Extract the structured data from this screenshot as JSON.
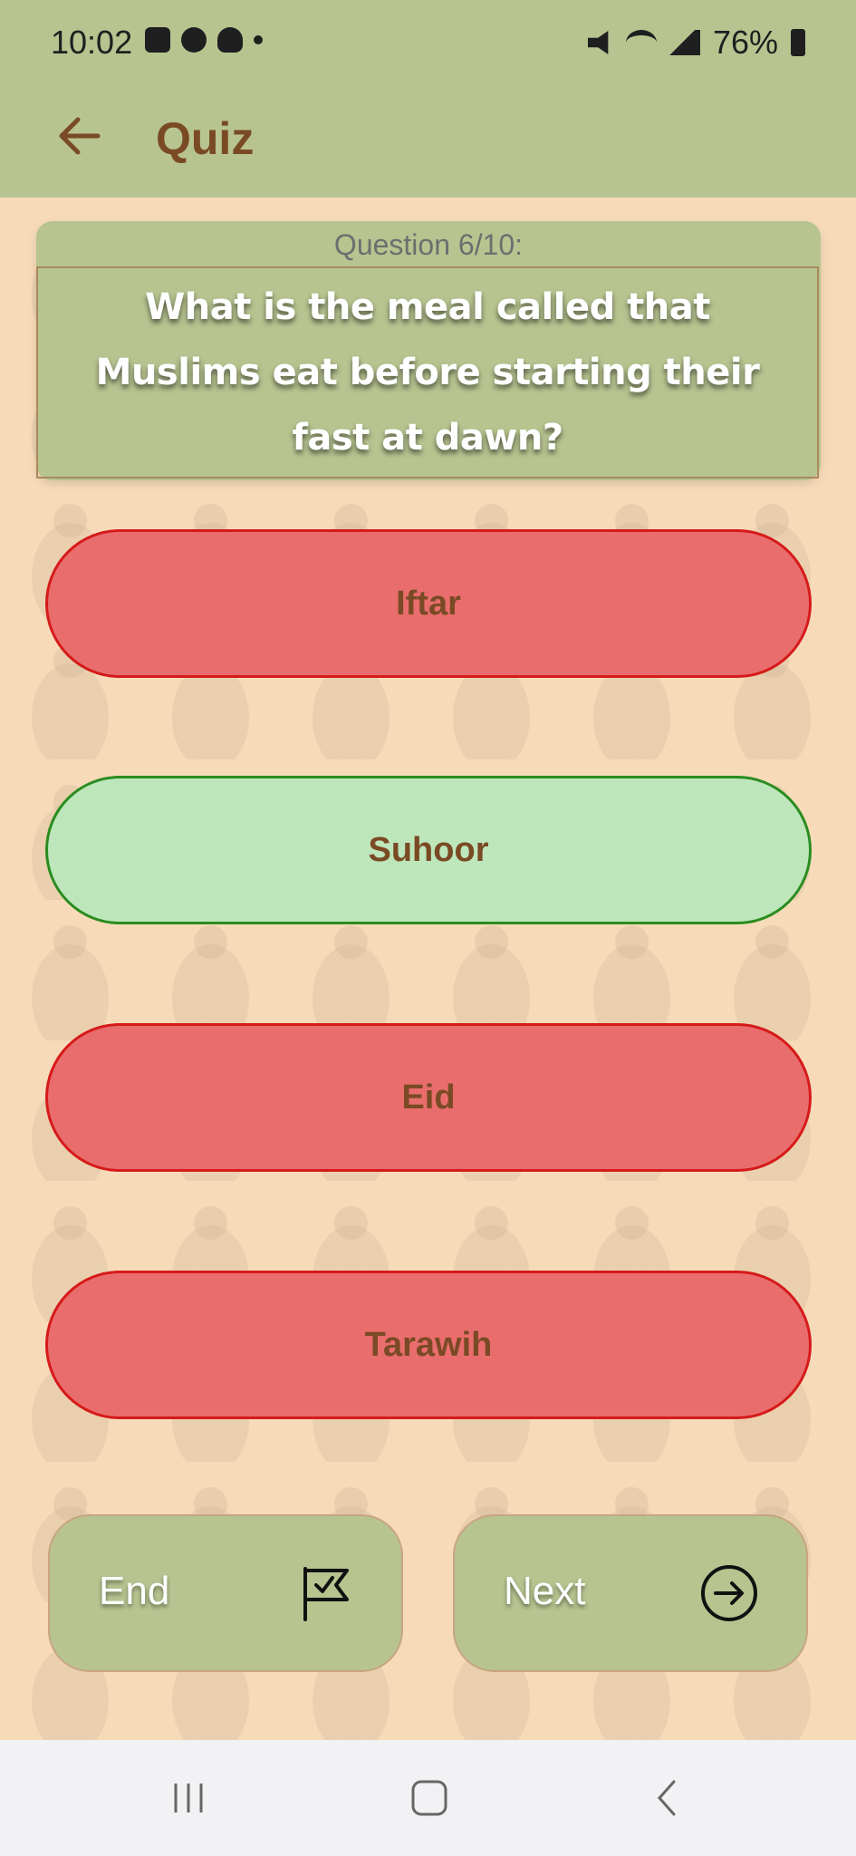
{
  "status_bar": {
    "time": "10:02",
    "battery": "76%",
    "icons_left": [
      "gallery-icon",
      "messenger-icon",
      "snapchat-icon",
      "dot-icon"
    ],
    "icons_right": [
      "mute-icon",
      "wifi-icon",
      "signal-icon",
      "battery-icon"
    ]
  },
  "app_bar": {
    "title": "Quiz"
  },
  "question": {
    "number": "Question 6/10:",
    "text": "What is the meal called that Muslims eat before starting their fast at dawn?"
  },
  "answers": [
    {
      "label": "Iftar",
      "state": "wrong"
    },
    {
      "label": "Suhoor",
      "state": "correct"
    },
    {
      "label": "Eid",
      "state": "wrong"
    },
    {
      "label": "Tarawih",
      "state": "wrong"
    }
  ],
  "footer": {
    "end_label": "End",
    "next_label": "Next"
  },
  "colors": {
    "bar": "#b7c490",
    "background": "#f6dcba",
    "wrong_fill": "#e96d6d",
    "wrong_border": "#d61a1a",
    "correct_fill": "#bde6bb",
    "correct_border": "#2a8c1f",
    "answer_text": "#7a4a25"
  }
}
